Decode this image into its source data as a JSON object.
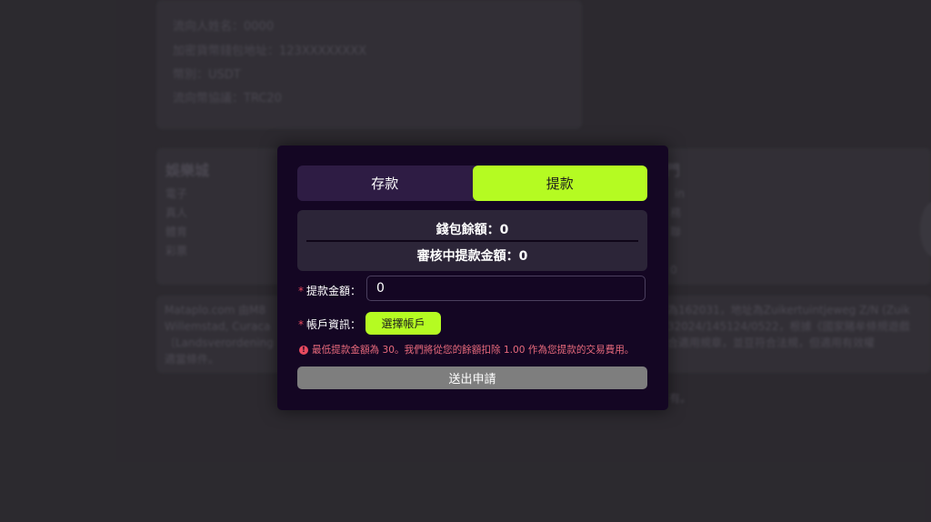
{
  "background": {
    "card_lines": [
      "流向人姓名：0000",
      "加密貨幣錢包地址：123XXXXXXXX",
      "幣別：USDT",
      "流向幣協議：TRC20"
    ],
    "left_section": {
      "heading": "娛樂城",
      "items": [
        "電子",
        "真人",
        "體育",
        "彩票"
      ]
    },
    "right_section": {
      "heading": "門",
      "items": [
        "in",
        "務",
        "聯",
        "0"
      ]
    },
    "license_lines": [
      "Mataplo.com 由M8",
      "Willemstad, Curaca",
      "〔Landsverordening",
      "適當條件。"
    ],
    "license_right_lines": [
      "為162031，地址為Zuikertuintjeweg Z/N (Zuik",
      "32024/145124/0522，根據《國家賭牟條規遊戲",
      "合適用規章，並豆符合法規，但適用有效權",
      ""
    ],
    "footer_fragment": "有。"
  },
  "modal": {
    "tabs": [
      {
        "label": "存款",
        "active": false
      },
      {
        "label": "提款",
        "active": true
      }
    ],
    "wallet_balance": "錢包餘額：0",
    "pending_withdrawal": "審核中提款金額：0",
    "amount_label": "提款金額：",
    "amount_value": "0",
    "account_label": "帳戶資訊：",
    "select_account_label": "選擇帳戶",
    "required_mark": "*",
    "warning_text": "最低提款金額為 30。我們將從您的餘額扣除 1.00 作為您提款的交易費用。",
    "warning_icon": "!",
    "submit_label": "送出申請"
  },
  "colors": {
    "accent": "#b5fb22",
    "modal_bg": "#140623",
    "warning": "#e86a7c",
    "submit_disabled": "#7e7e7e"
  }
}
